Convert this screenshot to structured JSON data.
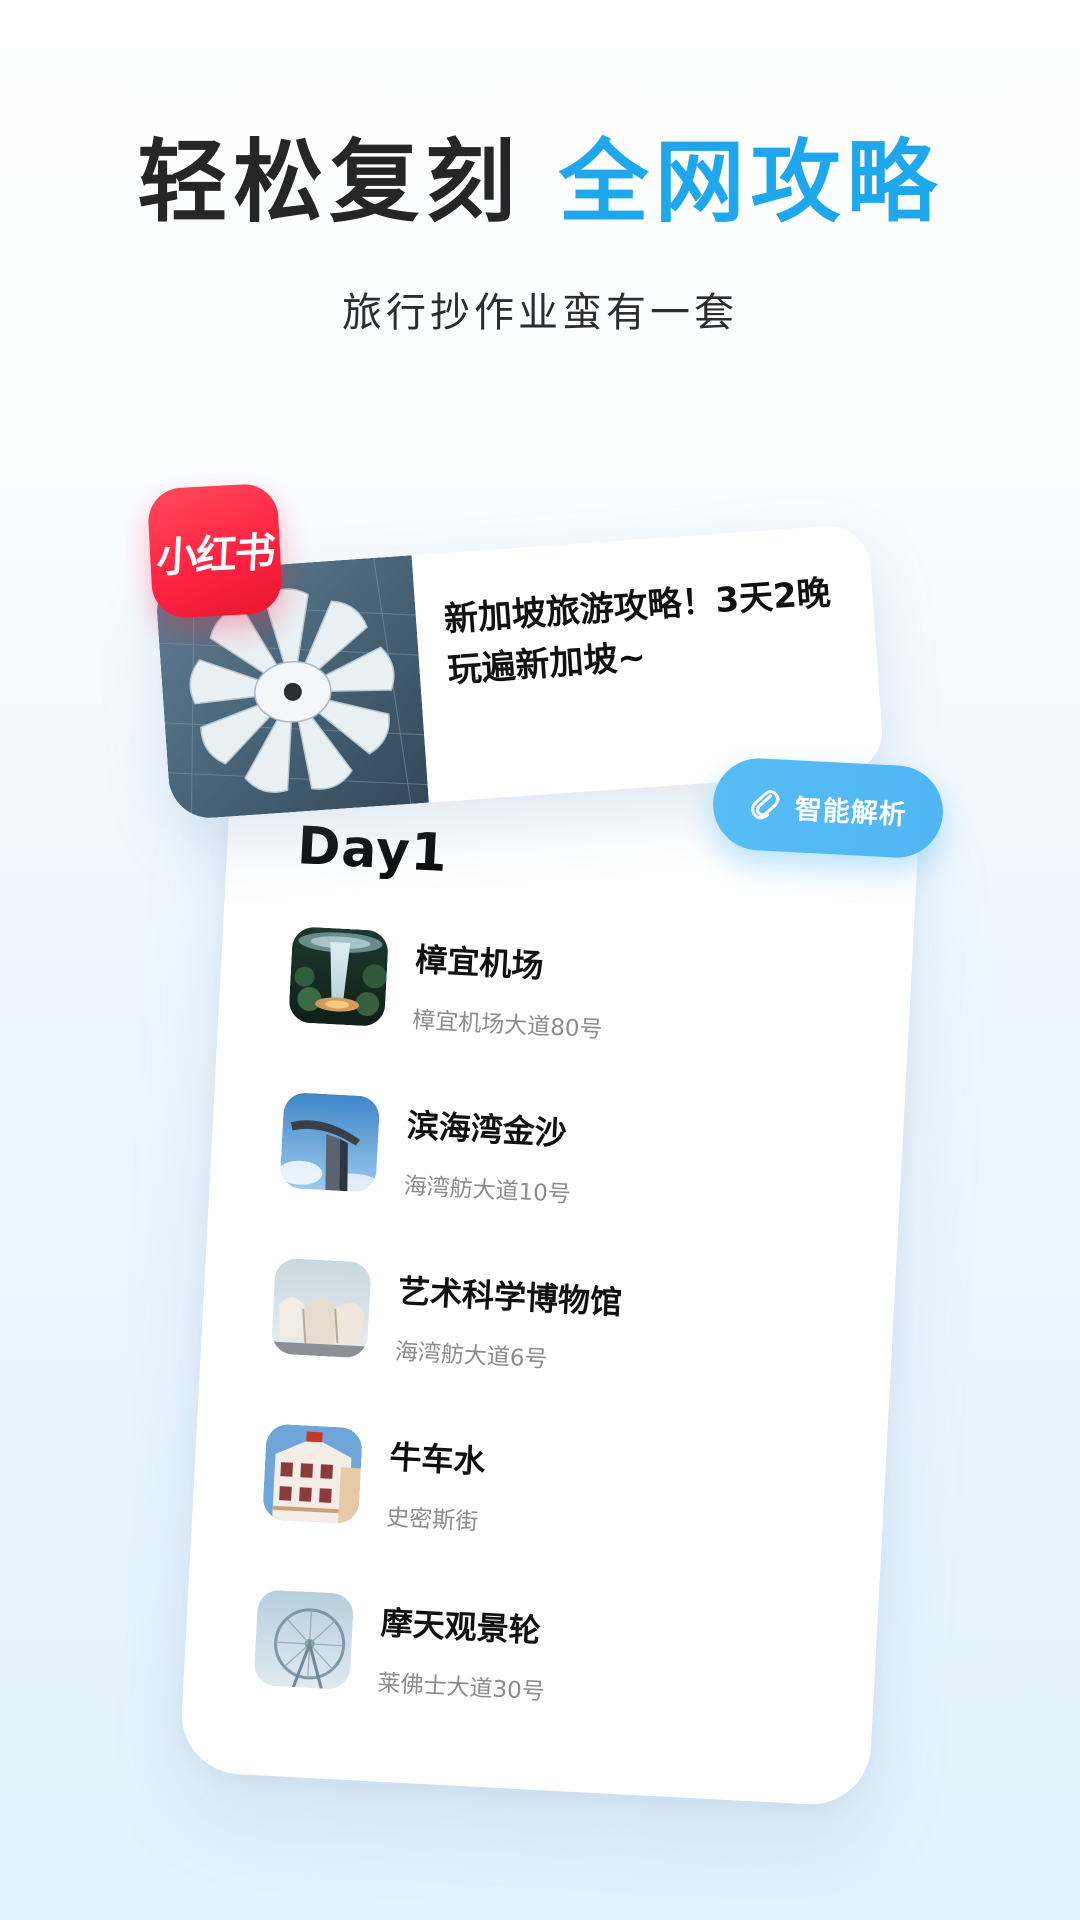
{
  "headline": {
    "part1": "轻松复刻",
    "part2": "全网攻略",
    "subtitle": "旅行抄作业蛮有一套"
  },
  "colors": {
    "accent_blue": "#1fa7ee",
    "badge_red": "#ff2442",
    "button_blue": "#4fb6f3"
  },
  "post": {
    "platform": "小红书",
    "title": "新加坡旅游攻略！3天2晚玩遍新加坡~"
  },
  "parse_button": {
    "label": "智能解析",
    "icon": "paperclip-icon"
  },
  "itinerary": {
    "day_label": "Day1",
    "places": [
      {
        "name": "樟宜机场",
        "address": "樟宜机场大道80号"
      },
      {
        "name": "滨海湾金沙",
        "address": "海湾舫大道10号"
      },
      {
        "name": "艺术科学博物馆",
        "address": "海湾舫大道6号"
      },
      {
        "name": "牛车水",
        "address": "史密斯街"
      },
      {
        "name": "摩天观景轮",
        "address": "莱佛士大道30号"
      }
    ]
  }
}
